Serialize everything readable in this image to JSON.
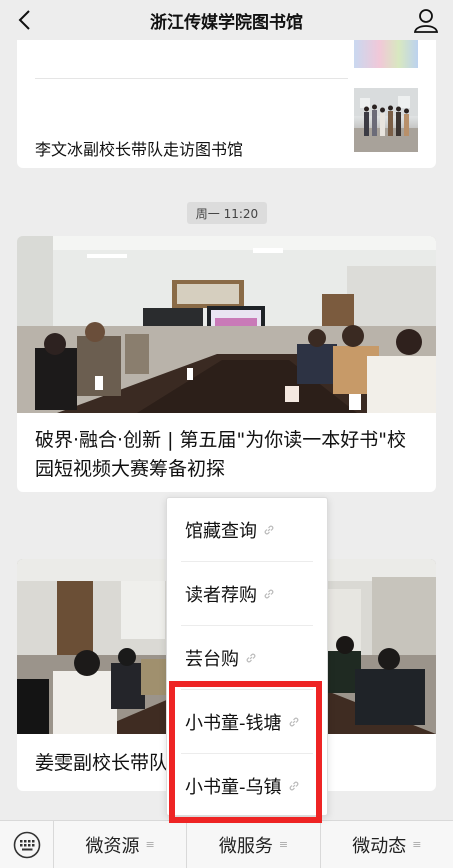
{
  "header": {
    "title": "浙江传媒学院图书馆"
  },
  "feed": {
    "top_item_title": "李文冰副校长带队走访图书馆",
    "timestamp": "周一 11:20",
    "article1_title": "破界·融合·创新 | 第五届\"为你读一本好书\"校园短视频大赛筹备初探",
    "article2_title": "姜雯副校长带队"
  },
  "popup_menu": {
    "items": [
      {
        "label": "馆藏查询",
        "icon": "link-icon"
      },
      {
        "label": "读者荐购",
        "icon": "link-icon"
      },
      {
        "label": "芸台购",
        "icon": "link-icon"
      },
      {
        "label": "小书童-钱塘",
        "icon": "link-icon"
      },
      {
        "label": "小书童-乌镇",
        "icon": "link-icon"
      }
    ]
  },
  "bottom_menu": {
    "tabs": [
      {
        "label": "微资源"
      },
      {
        "label": "微服务"
      },
      {
        "label": "微动态"
      }
    ]
  },
  "colors": {
    "highlight": "#ee2424",
    "background": "#ededed"
  }
}
